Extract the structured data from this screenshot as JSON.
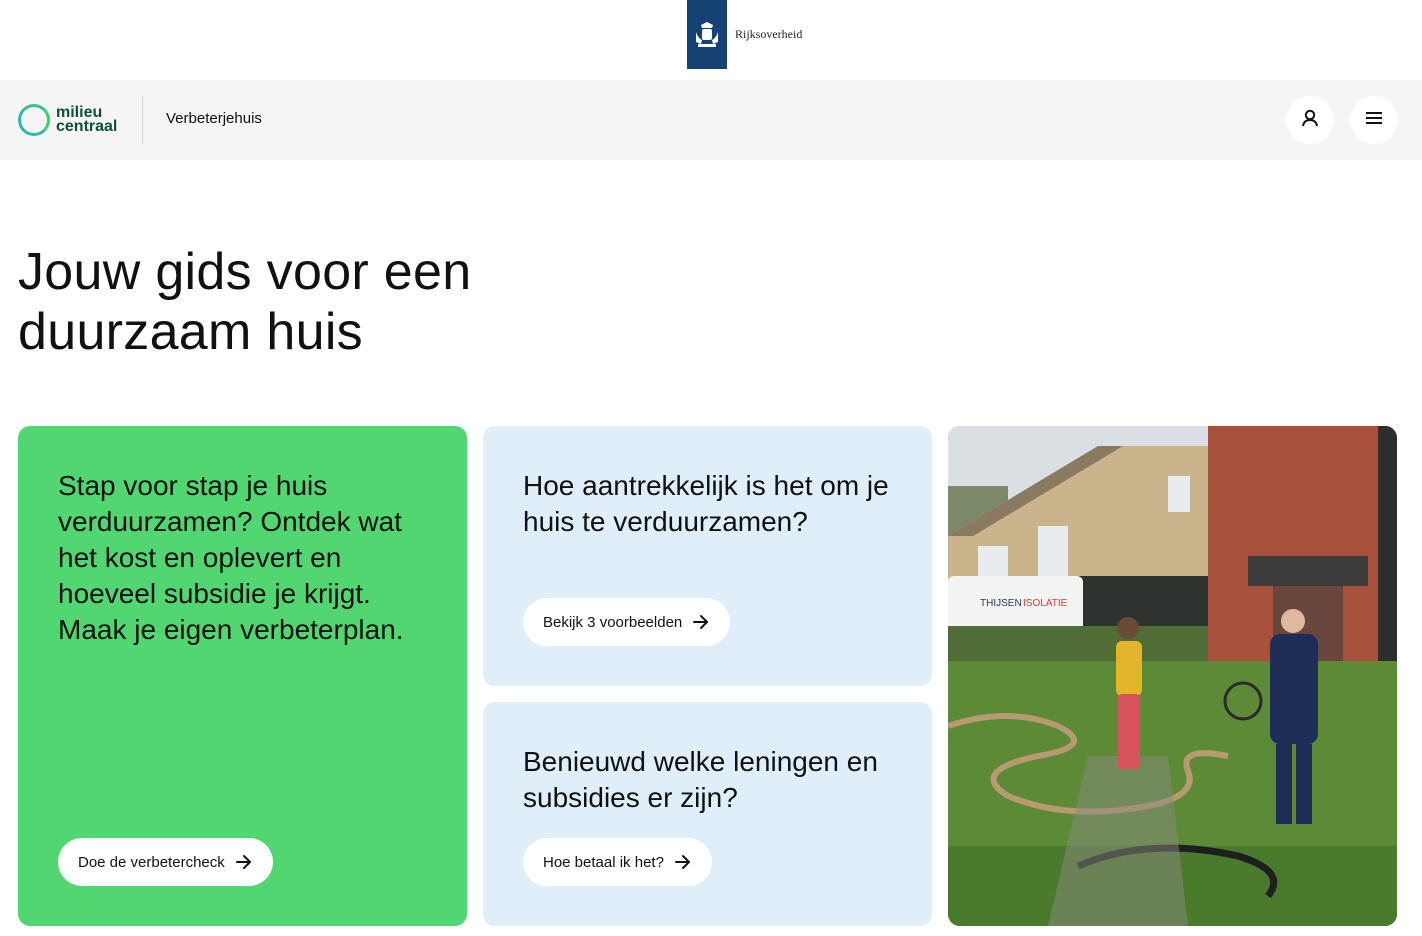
{
  "gov": {
    "name": "Rijksoverheid"
  },
  "header": {
    "logo_line1": "milieu",
    "logo_line2": "centraal",
    "site_name": "Verbeterjehuis",
    "account_icon": "user-icon",
    "menu_icon": "hamburger-menu-icon"
  },
  "hero": {
    "title": "Jouw gids voor een duurzaam huis"
  },
  "cards": [
    {
      "text": "Stap voor stap je huis verduurzamen? Ontdek wat het kost en oplevert en hoeveel subsidie je krijgt. Maak je eigen verbeterplan.",
      "button": "Doe de verbetercheck",
      "color": "#52d672"
    },
    {
      "text": "Hoe aantrekkelijk is het om je huis te verduurzamen?",
      "button": "Bekijk 3 voorbeelden",
      "color": "#e0eef9"
    },
    {
      "text": "Benieuwd welke leningen en subsidies er zijn?",
      "button": "Hoe betaal ik het?",
      "color": "#e0eef9"
    }
  ],
  "photo": {
    "van_text_1": "THIJSEN",
    "van_text_2": "ISOLATIE"
  }
}
